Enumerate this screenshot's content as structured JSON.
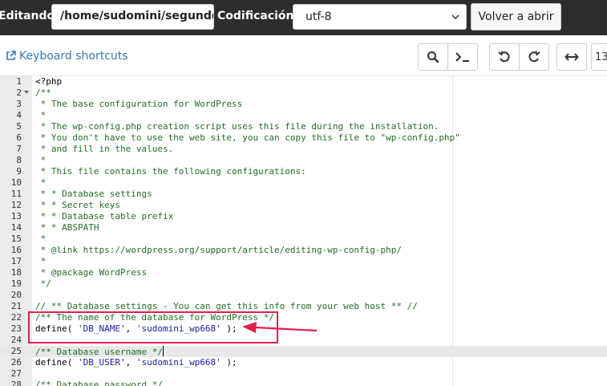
{
  "topbar": {
    "editing_label": "Editando:",
    "path_value": "/home/sudomini/segundo/wp-config.php",
    "encoding_label": "Codificación:",
    "encoding_value": "utf-8",
    "reopen_label": "Volver a abrir"
  },
  "toolbar": {
    "keyboard_shortcuts": "Keyboard shortcuts",
    "font_size_partial": "13"
  },
  "annotation_color": "#e01e4e",
  "comment_color": "#236e24",
  "string_color": "#1a1aa6",
  "editor": {
    "lines": [
      {
        "n": "1",
        "text": "<?php"
      },
      {
        "n": "2",
        "text": "/**"
      },
      {
        "n": "3",
        "text": " * The base configuration for WordPress"
      },
      {
        "n": "4",
        "text": " *"
      },
      {
        "n": "5",
        "text": " * The wp-config.php creation script uses this file during the installation."
      },
      {
        "n": "6",
        "text": " * You don't have to use the web site, you can copy this file to \"wp-config.php\""
      },
      {
        "n": "7",
        "text": " * and fill in the values."
      },
      {
        "n": "8",
        "text": " *"
      },
      {
        "n": "9",
        "text": " * This file contains the following configurations:"
      },
      {
        "n": "10",
        "text": " *"
      },
      {
        "n": "11",
        "text": " * * Database settings"
      },
      {
        "n": "12",
        "text": " * * Secret keys"
      },
      {
        "n": "13",
        "text": " * * Database table prefix"
      },
      {
        "n": "14",
        "text": " * * ABSPATH"
      },
      {
        "n": "15",
        "text": " *"
      },
      {
        "n": "16",
        "text": " * @link https://wordpress.org/support/article/editing-wp-config-php/"
      },
      {
        "n": "17",
        "text": " *"
      },
      {
        "n": "18",
        "text": " * @package WordPress"
      },
      {
        "n": "19",
        "text": " */"
      },
      {
        "n": "20",
        "text": ""
      },
      {
        "n": "21",
        "text": "// ** Database settings - You can get this info from your web host ** //"
      },
      {
        "n": "22",
        "text": "/** The name of the database for WordPress */"
      },
      {
        "n": "23",
        "kw": "define( ",
        "str": "'DB_NAME'",
        "mid": ", ",
        "str2": "'sudomini_wp668'",
        "end": " );"
      },
      {
        "n": "24",
        "text": ""
      },
      {
        "n": "25",
        "text": "/** Database username */"
      },
      {
        "n": "26",
        "kw": "define( ",
        "str": "'DB_USER'",
        "mid": ", ",
        "str2": "'sudomini_wp668'",
        "end": " );"
      },
      {
        "n": "27",
        "text": ""
      },
      {
        "n": "28",
        "text": "/** Database password */"
      }
    ]
  }
}
